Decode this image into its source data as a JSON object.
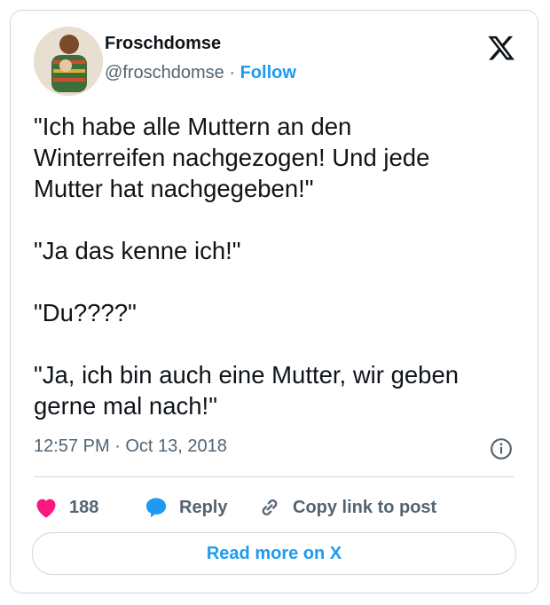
{
  "author": {
    "display_name": "Froschdomse",
    "handle": "@froschdomse",
    "separator": " · ",
    "follow_label": "Follow"
  },
  "tweet": {
    "text": "\"Ich habe alle Muttern an den\nWinterreifen nachgezogen! Und jede\nMutter hat nachgegeben!\"\n\n\"Ja das kenne ich!\"\n\n\"Du????\"\n\n\"Ja, ich bin auch eine Mutter, wir geben\ngerne mal nach!\"",
    "timestamp": "12:57 PM · Oct 13, 2018"
  },
  "actions": {
    "likes_count": "188",
    "reply_label": "Reply",
    "copy_link_label": "Copy link to post"
  },
  "footer": {
    "read_more_label": "Read more on X"
  },
  "colors": {
    "like": "#f91880",
    "reply": "#1d9bf0",
    "link": "#1d9bf0",
    "muted": "#536471",
    "border": "#cfd9de"
  },
  "icons": [
    "x-logo-icon",
    "info-icon",
    "heart-icon",
    "reply-bubble-icon",
    "link-icon"
  ]
}
